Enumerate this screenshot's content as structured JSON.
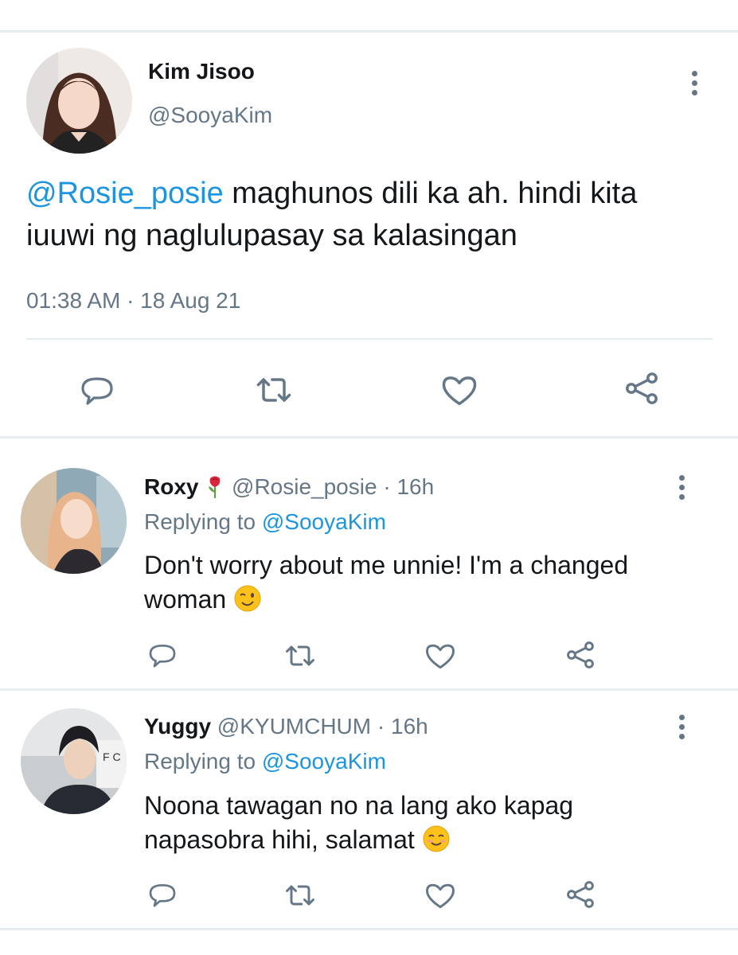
{
  "main_tweet": {
    "author_name": "Kim Jisoo",
    "author_handle": "@SooyaKim",
    "mention": "@Rosie_posie",
    "text_line1": "maghunos dili ka ah. hindi kita",
    "text_line2": "iuuwi ng naglulupasay sa kalasingan",
    "timestamp": "01:38 AM · 18 Aug 21"
  },
  "replies": [
    {
      "author_name": "Roxy",
      "author_emoji": "rose-emoji",
      "author_handle": "@Rosie_posie",
      "time": "· 16h",
      "replying_label": "Replying to",
      "replying_handle": "@SooyaKim",
      "text_line1": "Don't worry about me unnie! I'm a changed",
      "text_line2": "woman",
      "trailing_emoji": "winking-face-emoji"
    },
    {
      "author_name": "Yuggy",
      "author_handle": "@KYUMCHUM",
      "time": "· 16h",
      "replying_label": "Replying to",
      "replying_handle": "@SooyaKim",
      "text_line1": "Noona tawagan no na lang ako kapag",
      "text_line2": "napasobra hihi, salamat",
      "trailing_emoji": "smiling-face-emoji"
    }
  ],
  "icons": [
    "reply-icon",
    "retweet-icon",
    "like-icon",
    "share-icon",
    "more-options-icon"
  ],
  "colors": {
    "link": "#1b95e0",
    "secondary_text": "#657786",
    "divider": "#e6ecf0",
    "icon": "#657786"
  }
}
